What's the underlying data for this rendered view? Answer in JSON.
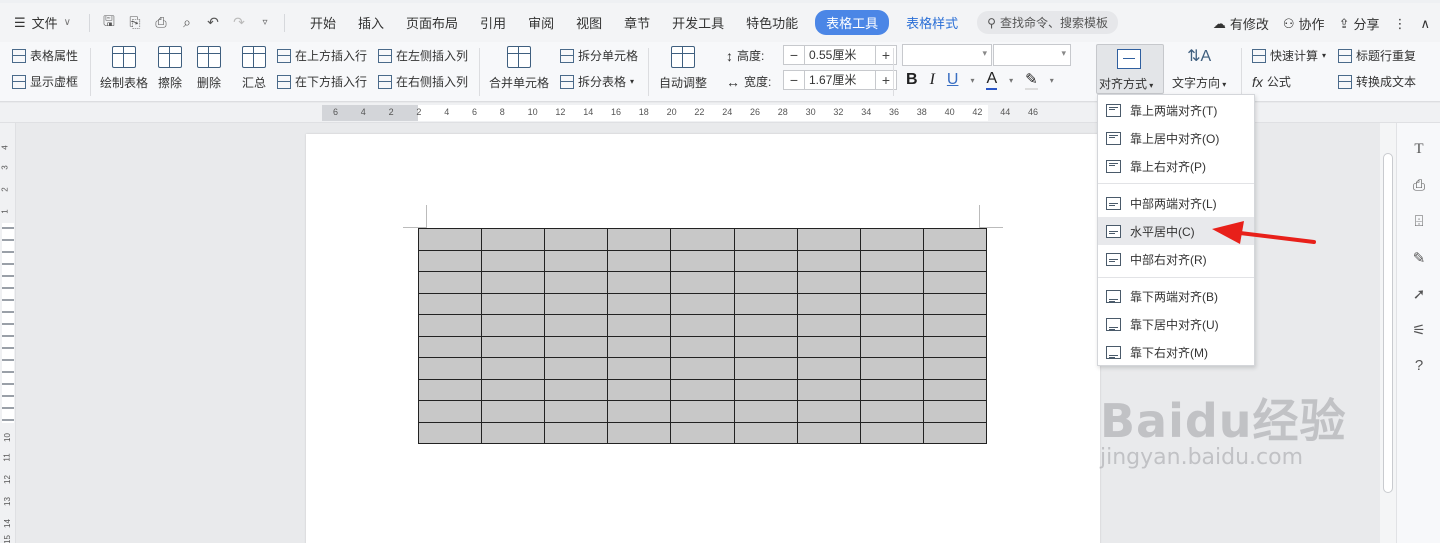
{
  "menubar": {
    "file_label": "文件",
    "tabs": [
      "开始",
      "插入",
      "页面布局",
      "引用",
      "审阅",
      "视图",
      "章节",
      "开发工具",
      "特色功能",
      "表格工具",
      "表格样式"
    ],
    "active_tab": "表格工具",
    "search_placeholder": "查找命令、搜索模板",
    "modified_label": "有修改",
    "collab_label": "协作",
    "share_label": "分享"
  },
  "ribbon": {
    "table_props": "表格属性",
    "show_gridlines": "显示虚框",
    "draw_table": "绘制表格",
    "erase": "擦除",
    "delete": "删除",
    "summary": "汇总",
    "insert_row_above": "在上方插入行",
    "insert_row_below": "在下方插入行",
    "insert_col_left": "在左侧插入列",
    "insert_col_right": "在右侧插入列",
    "merge_cells": "合并单元格",
    "split_cells": "拆分单元格",
    "split_table": "拆分表格",
    "auto_fit": "自动调整",
    "height_label": "高度:",
    "height_value": "0.55厘米",
    "width_label": "宽度:",
    "width_value": "1.67厘米",
    "bold": "B",
    "italic": "I",
    "underline": "U",
    "font_color": "A",
    "align_label": "对齐方式",
    "text_dir": "文字方向",
    "quick_calc": "快速计算",
    "formula": "公式",
    "header_repeat": "标题行重复",
    "to_text": "转换成文本"
  },
  "ruler_numbers": [
    "6",
    "4",
    "2",
    "2",
    "4",
    "6",
    "8",
    "10",
    "12",
    "14",
    "16",
    "18",
    "20",
    "22",
    "24",
    "26",
    "28",
    "30",
    "32",
    "34",
    "36",
    "38",
    "40",
    "42",
    "44",
    "46"
  ],
  "vruler_numbers": [
    "4",
    "3",
    "2",
    "1",
    "10",
    "11",
    "12",
    "13",
    "14",
    "15"
  ],
  "table": {
    "rows": 10,
    "cols": 9,
    "fill_color": "#c8c8c8"
  },
  "align_menu": {
    "items": [
      {
        "label": "靠上两端对齐(T)",
        "icon": "align-top-justify-icon"
      },
      {
        "label": "靠上居中对齐(O)",
        "icon": "align-top-center-icon"
      },
      {
        "label": "靠上右对齐(P)",
        "icon": "align-top-right-icon"
      },
      {
        "label": "中部两端对齐(L)",
        "icon": "align-middle-justify-icon"
      },
      {
        "label": "水平居中(C)",
        "icon": "align-center-icon"
      },
      {
        "label": "中部右对齐(R)",
        "icon": "align-middle-right-icon"
      },
      {
        "label": "靠下两端对齐(B)",
        "icon": "align-bottom-justify-icon"
      },
      {
        "label": "靠下居中对齐(U)",
        "icon": "align-bottom-center-icon"
      },
      {
        "label": "靠下右对齐(M)",
        "icon": "align-bottom-right-icon"
      }
    ],
    "selected_index": 4
  },
  "watermark": {
    "brand": "Baidu经验",
    "url": "jingyan.baidu.com"
  },
  "colors": {
    "accent": "#4b86e6",
    "arrow": "#e8201a",
    "cell": "#c8c8c8"
  }
}
